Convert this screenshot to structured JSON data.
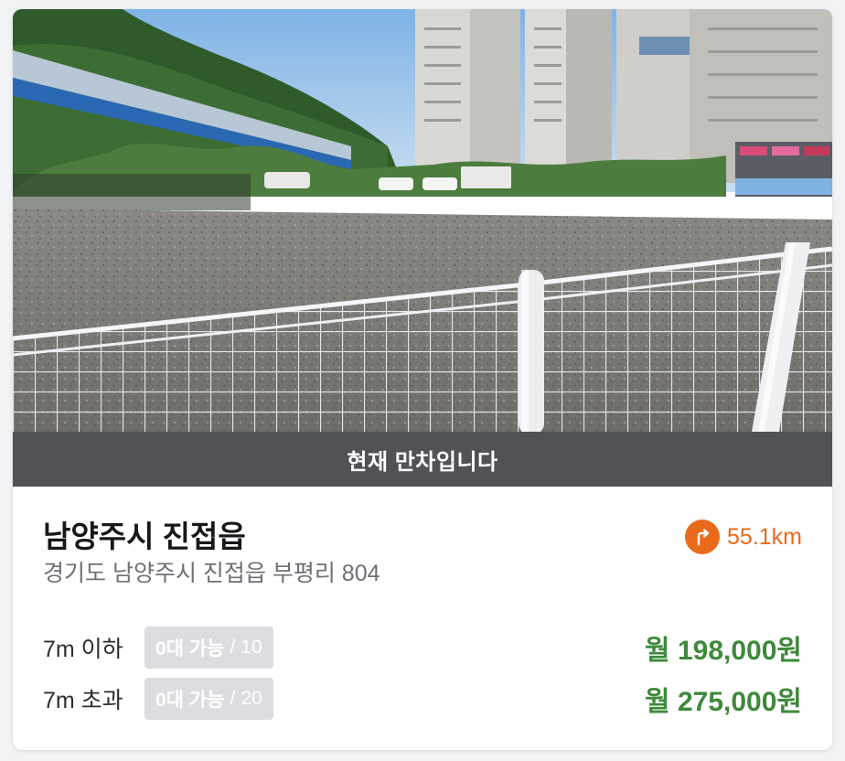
{
  "parking_lot": {
    "status_banner": "현재 만차입니다",
    "name": "남양주시 진접읍",
    "address": "경기도 남양주시 진접읍 부평리 804",
    "distance": "55.1km",
    "directions_icon": "turn-right-arrow-icon",
    "photo_subject": "gravel-lot-with-white-fence",
    "rates": [
      {
        "size_label": "7m 이하",
        "available_text": "0대 가능",
        "separator": "/",
        "capacity": "10",
        "price": "월 198,000원"
      },
      {
        "size_label": "7m 초과",
        "available_text": "0대 가능",
        "separator": "/",
        "capacity": "20",
        "price": "월 275,000원"
      }
    ]
  },
  "colors": {
    "accent_orange": "#ea6a1c",
    "price_green": "#3e8a3b",
    "banner_bg": "#505258",
    "pill_bg": "#dcdde0"
  }
}
